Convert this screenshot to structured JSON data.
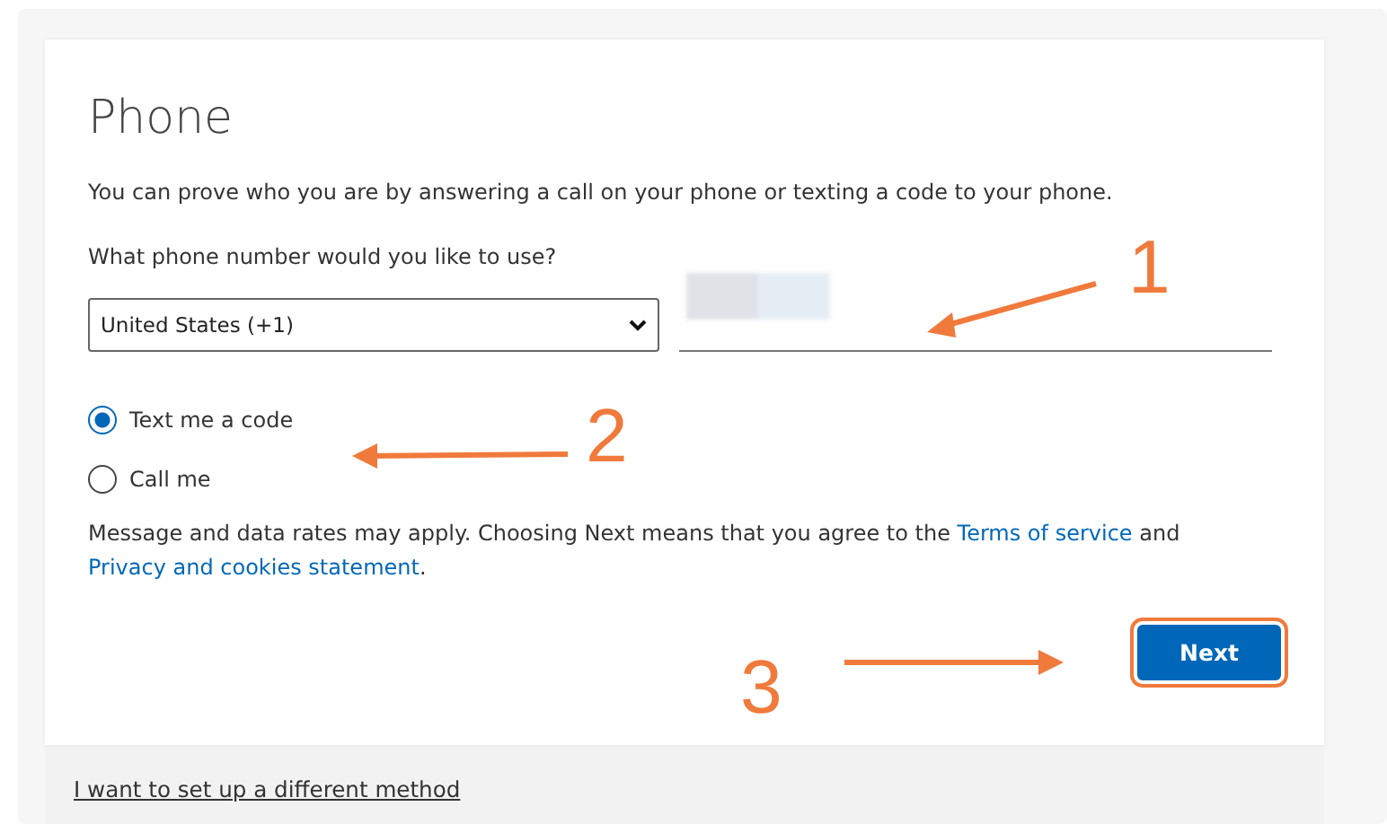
{
  "title": "Phone",
  "intro": "You can prove who you are by answering a call on your phone or texting a code to your phone.",
  "question": "What phone number would you like to use?",
  "country_select": {
    "value": "United States (+1)"
  },
  "phone_field": {
    "redacted": true
  },
  "options": [
    {
      "label": "Text me a code",
      "selected": true
    },
    {
      "label": "Call me",
      "selected": false
    }
  ],
  "notice": {
    "text": "Message and data rates may apply. Choosing Next means that you agree to the ",
    "link_1": "Terms of service",
    "middle": " and ",
    "link_2": "Privacy and cookies statement",
    "end": "."
  },
  "next_button": {
    "label": "Next",
    "highlighted": true
  },
  "footer_link": "I want to set up a different method",
  "annotations": [
    {
      "label": "1",
      "kind": "left"
    },
    {
      "label": "2",
      "kind": "left"
    },
    {
      "label": "3",
      "kind": "right"
    }
  ]
}
